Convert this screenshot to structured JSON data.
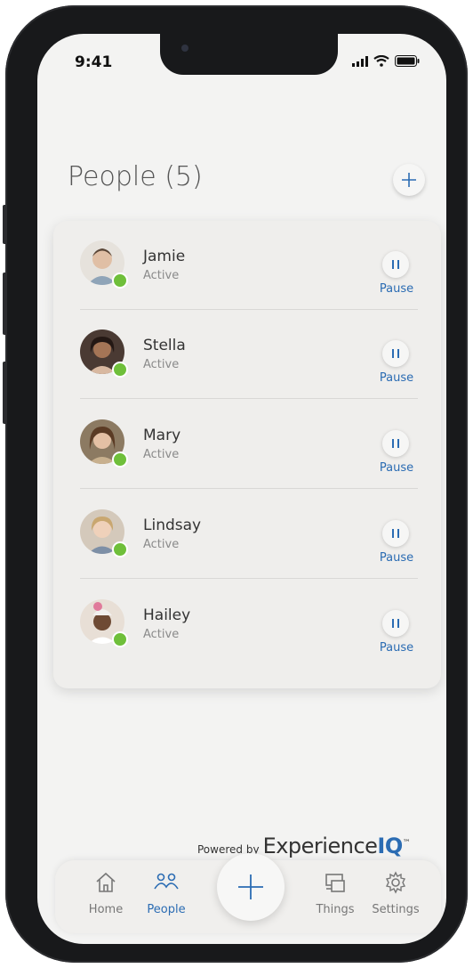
{
  "status_bar": {
    "time": "9:41"
  },
  "header": {
    "title": "People (5)",
    "add_icon": "plus-icon"
  },
  "people": [
    {
      "name": "Jamie",
      "status": "Active",
      "pause_label": "Pause",
      "avatar_bg": "#b9a58f"
    },
    {
      "name": "Stella",
      "status": "Active",
      "pause_label": "Pause",
      "avatar_bg": "#3e2e28"
    },
    {
      "name": "Mary",
      "status": "Active",
      "pause_label": "Pause",
      "avatar_bg": "#6b5138"
    },
    {
      "name": "Lindsay",
      "status": "Active",
      "pause_label": "Pause",
      "avatar_bg": "#c9b9a5"
    },
    {
      "name": "Hailey",
      "status": "Active",
      "pause_label": "Pause",
      "avatar_bg": "#d8c9b8"
    }
  ],
  "footer": {
    "powered_by": "Powered by",
    "brand_main": "Experience",
    "brand_accent": "IQ",
    "brand_tm": "™"
  },
  "tabs": [
    {
      "label": "Home",
      "icon": "home-icon",
      "active": false
    },
    {
      "label": "People",
      "icon": "people-icon",
      "active": true
    },
    {
      "label": "Things",
      "icon": "devices-icon",
      "active": false
    },
    {
      "label": "Settings",
      "icon": "gear-icon",
      "active": false
    }
  ],
  "colors": {
    "accent": "#2b6cb3",
    "status_active": "#6fbf3a",
    "background": "#f3f3f2"
  }
}
